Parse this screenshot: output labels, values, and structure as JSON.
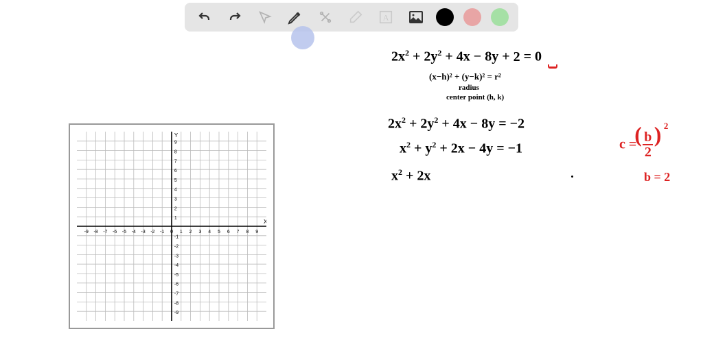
{
  "toolbar": {
    "undo_label": "undo",
    "redo_label": "redo",
    "pointer_label": "pointer",
    "pen_label": "pen",
    "tools_label": "tools",
    "eraser_label": "eraser",
    "text_label": "text",
    "image_label": "image",
    "colors": [
      "#000000",
      "#e8a5a5",
      "#a5e0a5"
    ]
  },
  "graph": {
    "x_label": "X",
    "y_label": "Y",
    "x_ticks": [
      "-9",
      "-8",
      "-7",
      "-6",
      "-5",
      "-4",
      "-3",
      "-2",
      "-1",
      "0",
      "1",
      "2",
      "3",
      "4",
      "5",
      "6",
      "7",
      "8",
      "9"
    ],
    "y_ticks": [
      "-9",
      "-8",
      "-7",
      "-6",
      "-5",
      "-4",
      "-3",
      "-2",
      "-1",
      "1",
      "2",
      "3",
      "4",
      "5",
      "6",
      "7",
      "8",
      "9"
    ]
  },
  "equations": {
    "line1": "2x² + 2y² + 4x − 8y + 2 = 0",
    "circle_form": "(x−h)² + (y−k)² = r²",
    "radius_label": "radius",
    "center_label": "center point (h, k)",
    "line2": "2x² + 2y² + 4x − 8y = −2",
    "line3": "x² + y² + 2x − 4y = −1",
    "line4": "x² + 2x",
    "c_formula_left": "c =",
    "c_formula_frac_top": "b",
    "c_formula_frac_bot": "2",
    "c_formula_exp": "2",
    "b_value": "b = 2"
  }
}
